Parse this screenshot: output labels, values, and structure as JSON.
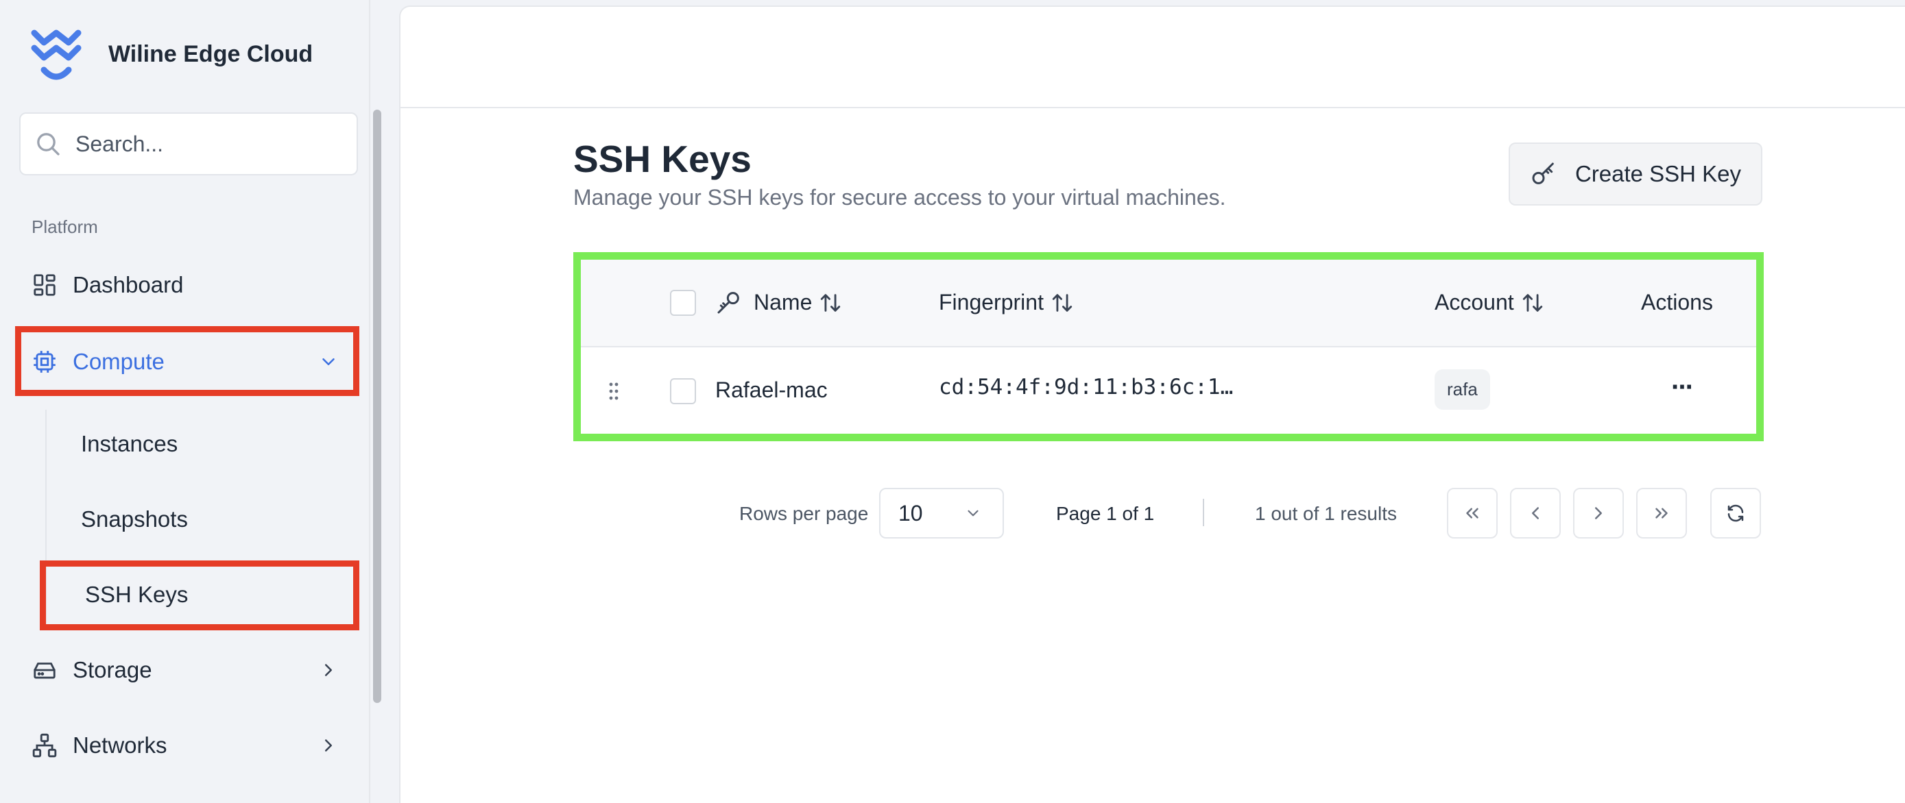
{
  "brand": {
    "name": "Wiline Edge Cloud"
  },
  "search": {
    "placeholder": "Search..."
  },
  "sidebar": {
    "section_label": "Platform",
    "items": [
      {
        "label": "Dashboard",
        "icon": "dashboard-icon"
      },
      {
        "label": "Compute",
        "icon": "cpu-icon",
        "expanded": true,
        "active": true
      },
      {
        "label": "Storage",
        "icon": "hard-drive-icon"
      },
      {
        "label": "Networks",
        "icon": "network-icon"
      }
    ],
    "compute_children": [
      {
        "label": "Instances"
      },
      {
        "label": "Snapshots"
      },
      {
        "label": "SSH Keys",
        "active": true
      }
    ]
  },
  "page": {
    "title": "SSH Keys",
    "subtitle": "Manage your SSH keys for secure access to your virtual machines.",
    "create_button": "Create SSH Key"
  },
  "table": {
    "columns": {
      "name": "Name",
      "fingerprint": "Fingerprint",
      "account": "Account",
      "actions": "Actions"
    },
    "rows": [
      {
        "name": "Rafael-mac",
        "fingerprint": "cd:54:4f:9d:11:b3:6c:1…",
        "account": "rafa",
        "actions": "···"
      }
    ]
  },
  "pagination": {
    "rows_per_page_label": "Rows per page",
    "rows_per_page_value": "10",
    "page_info": "Page 1 of 1",
    "results": "1 out of 1 results"
  },
  "colors": {
    "accent": "#3b6fe0",
    "highlight_red": "#e53c26",
    "highlight_green": "#7aeb55"
  }
}
